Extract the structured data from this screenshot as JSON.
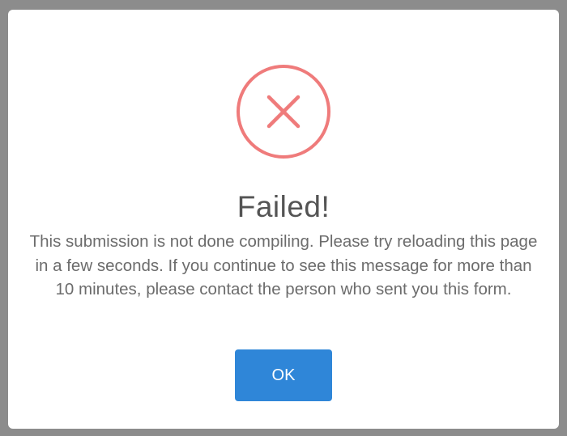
{
  "dialog": {
    "status_icon": "error-x-icon",
    "title": "Failed!",
    "message": "This submission is not done compiling. Please try reloading this page in a few seconds. If you continue to see this message for more than 10 minutes, please contact the person who sent you this form.",
    "ok_label": "OK"
  },
  "colors": {
    "error": "#ef7b7b",
    "button": "#2f86d8",
    "title": "#545454",
    "message": "#6c6c6c"
  }
}
